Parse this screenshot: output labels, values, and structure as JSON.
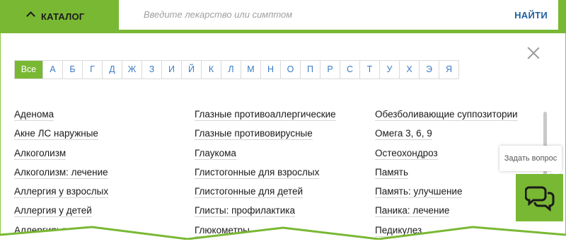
{
  "header": {
    "catalog_label": "КАТАЛОГ",
    "search_placeholder": "Введите лекарство или симптом",
    "search_button": "НАЙТИ"
  },
  "alphabet": {
    "letters": [
      "Все",
      "А",
      "Б",
      "Г",
      "Д",
      "Ж",
      "З",
      "И",
      "Й",
      "К",
      "Л",
      "М",
      "Н",
      "О",
      "П",
      "Р",
      "С",
      "Т",
      "У",
      "Х",
      "Э",
      "Я"
    ],
    "active": "Все"
  },
  "columns": [
    [
      "Аденома",
      "Акне ЛС наружные",
      "Алкоголизм",
      "Алкоголизм: лечение",
      "Аллергия у взрослых",
      "Аллергия у детей",
      "Аллергия: лечение"
    ],
    [
      "Глазные противоаллергические",
      "Глазные противовирусные",
      "Глаукома",
      "Глистогонные для взрослых",
      "Глистогонные для детей",
      "Глисты: профилактика",
      "Глюкометры"
    ],
    [
      "Обезболивающие суппозитории",
      "Омега 3, 6, 9",
      "Остеохондроз",
      "Память",
      "Память: улучшение",
      "Паника: лечение",
      "Педикулез"
    ]
  ],
  "widget": {
    "tooltip": "Задать вопрос",
    "icon": "chat-bubbles-icon"
  },
  "colors": {
    "accent": "#79b833",
    "link": "#3b7bc6",
    "search_button": "#1f5f9f"
  }
}
